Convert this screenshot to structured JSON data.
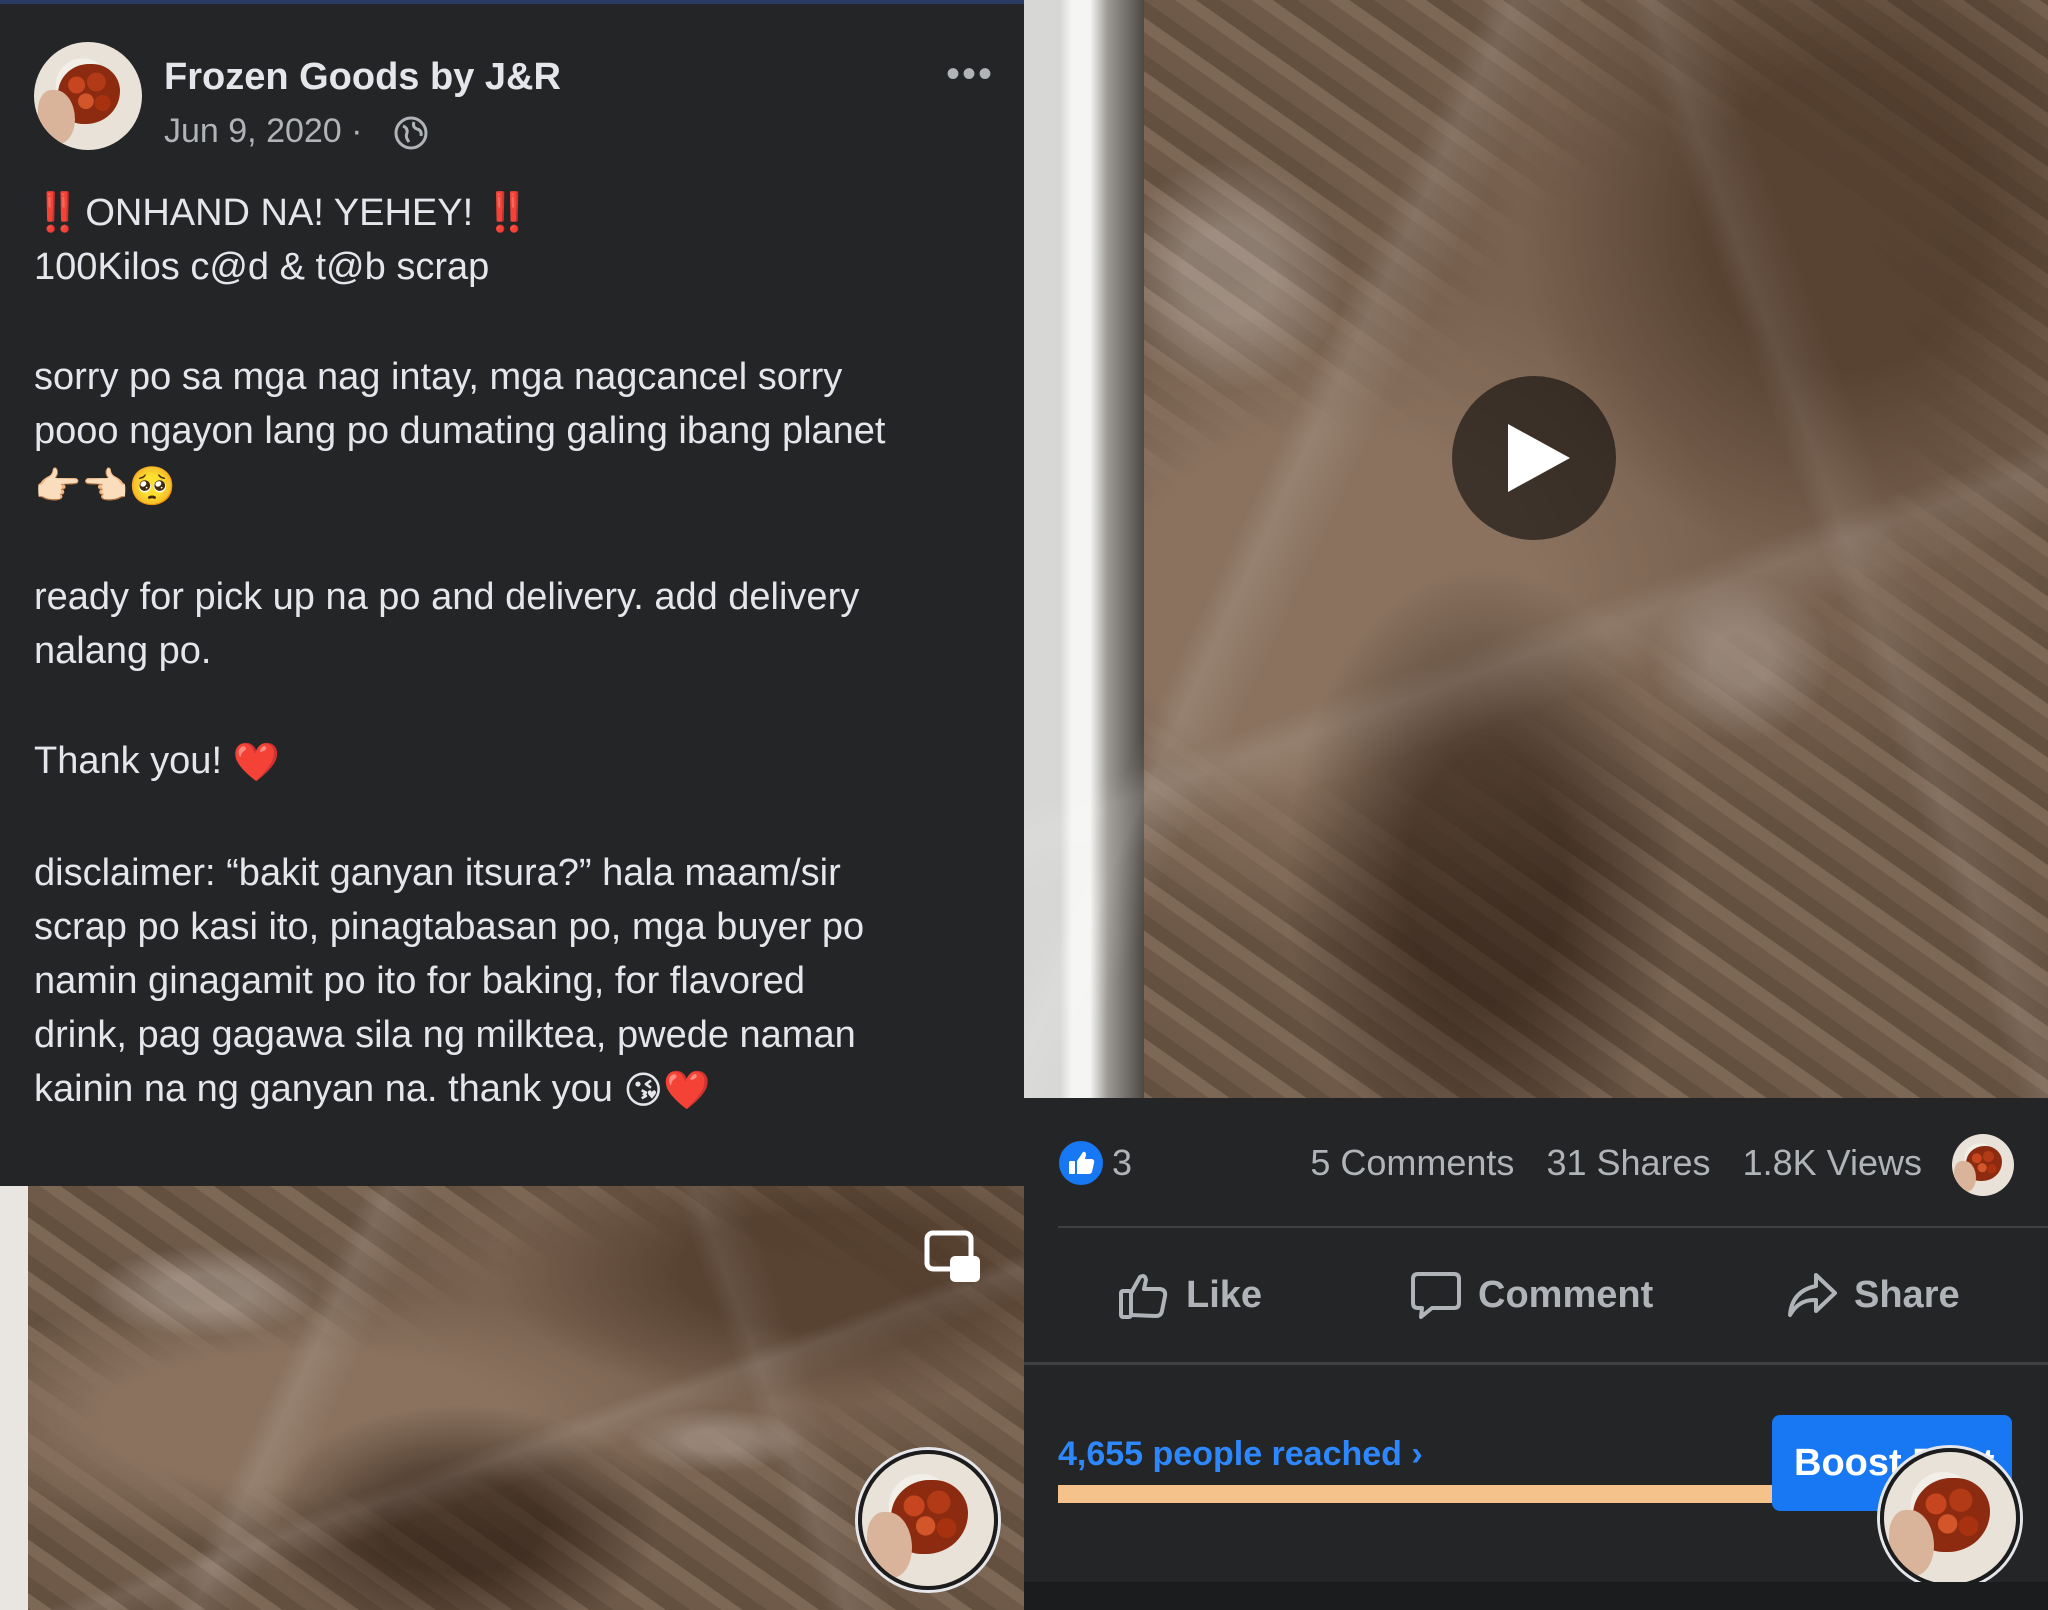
{
  "post": {
    "author": "Frozen Goods by J&R",
    "date": "Jun 9, 2020 ·",
    "more_label": "•••",
    "line1_excl": "‼️",
    "line1_text": "ONHAND NA! YEHEY!",
    "line2": "100Kilos c@d & t@b scrap",
    "para2a": "sorry po sa mga nag intay, mga nagcancel sorry",
    "para2b": "pooo ngayon lang po dumating galing ibang planet",
    "para2_emoji": "👉🏻👈🏻🥺",
    "para3a": "ready for pick up na po and delivery. add delivery",
    "para3b": "nalang po.",
    "para4": "Thank you!",
    "para4_emoji": "❤️",
    "para5a": "disclaimer: “bakit ganyan itsura?” hala maam/sir",
    "para5b": "scrap po kasi ito, pinagtabasan po, mga buyer po",
    "para5c": "namin ginagamit po ito for baking, for flavored",
    "para5d": "drink, pag gagawa sila ng milktea, pwede naman",
    "para5e": "kainin na ng ganyan na. thank you",
    "para5_emoji": "😘❤️"
  },
  "stats": {
    "likes": "3",
    "comments": "5 Comments",
    "shares": "31 Shares",
    "views": "1.8K Views"
  },
  "actions": {
    "like": "Like",
    "comment": "Comment",
    "share": "Share"
  },
  "insights": {
    "reached": "4,655 people reached",
    "boost": "Boost Post"
  },
  "colors": {
    "background": "#242526",
    "primary_text": "#e4e6eb",
    "secondary_text": "#b0b3b8",
    "accent_blue": "#1877f2",
    "link_blue": "#2d88ff",
    "reach_bar": "#f6c28b"
  }
}
